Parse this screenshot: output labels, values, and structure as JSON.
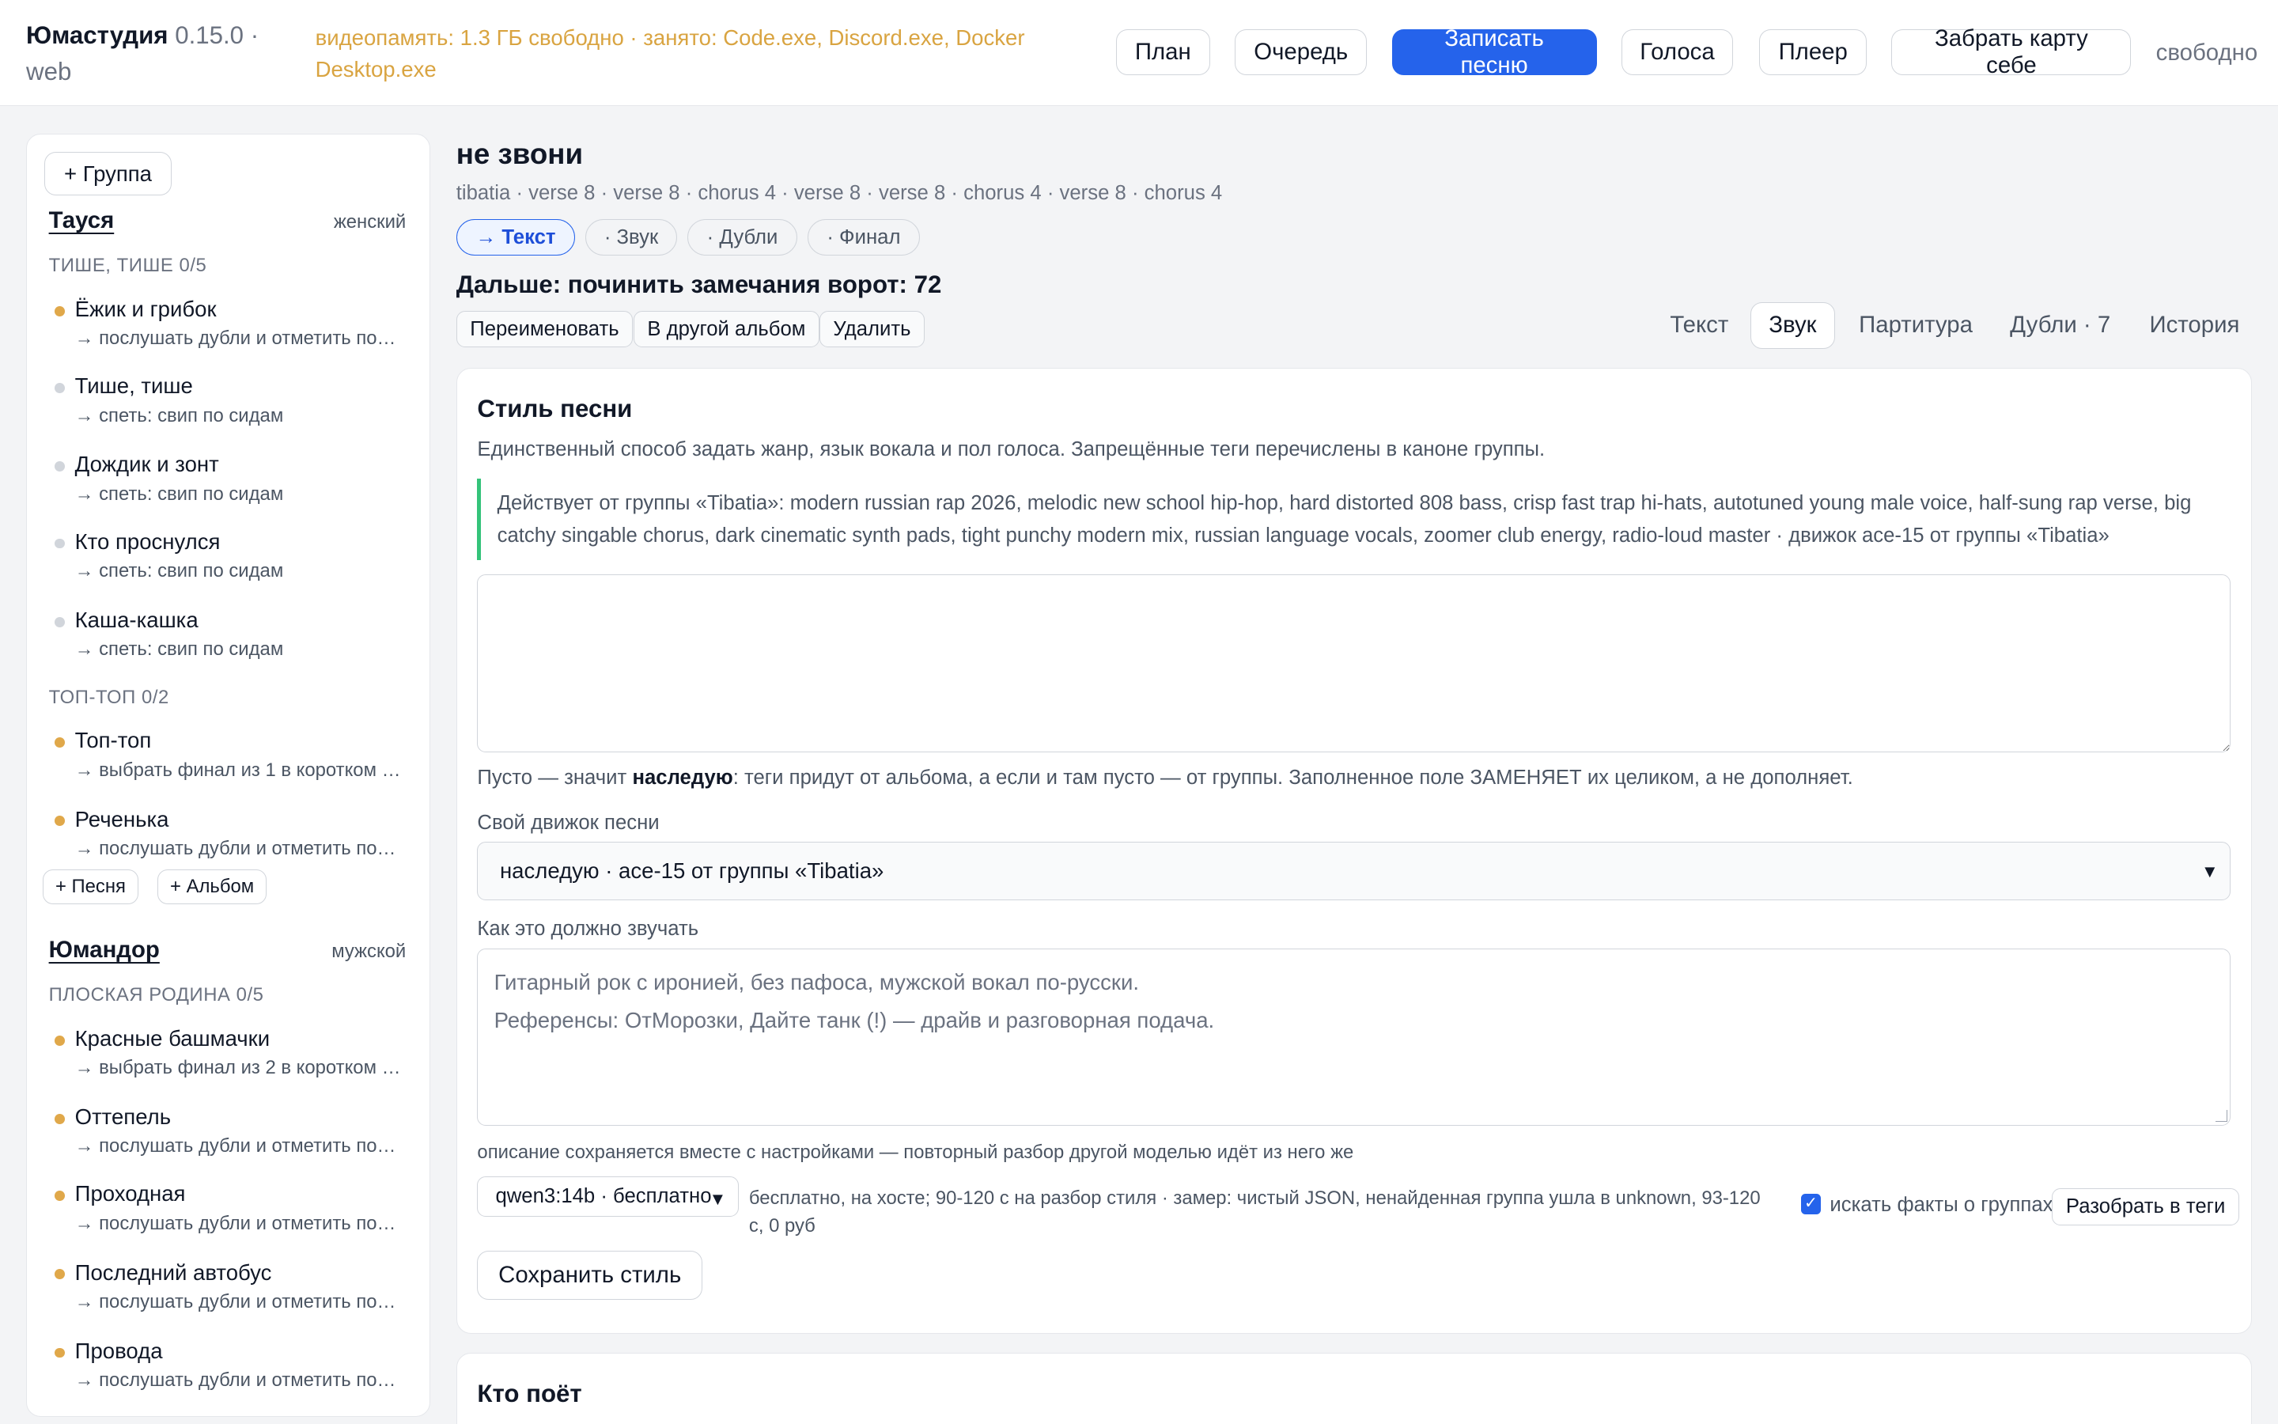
{
  "header": {
    "app_name": "Юмастудия",
    "version": "0.15.0 · web",
    "vram_status": "видеопамять: 1.3 ГБ свободно · занято: Code.exe, Discord.exe, Docker Desktop.exe",
    "nav": {
      "plan": "План",
      "queue": "Очередь",
      "record": "Записать песню",
      "voices": "Голоса",
      "player": "Плеер",
      "take_card": "Забрать карту себе"
    },
    "status": "свободно"
  },
  "sidebar": {
    "add_group": "+ Группа",
    "add_song": "+ Песня",
    "add_album": "+ Альбом",
    "groups": [
      {
        "name": "Тауся",
        "voice": "женский",
        "albums": [
          {
            "title": "ТИШЕ, ТИШЕ 0/5",
            "songs": [
              {
                "title": "Ёжик и грибок",
                "next": "→ послушать дубли и отметить понравившиеся",
                "status": "orange"
              },
              {
                "title": "Тише, тише",
                "next": "→ спеть: свип по сидам",
                "status": "gray"
              },
              {
                "title": "Дождик и зонт",
                "next": "→ спеть: свип по сидам",
                "status": "gray"
              },
              {
                "title": "Кто проснулся",
                "next": "→ спеть: свип по сидам",
                "status": "gray"
              },
              {
                "title": "Каша-кашка",
                "next": "→ спеть: свип по сидам",
                "status": "gray"
              }
            ]
          },
          {
            "title": "ТОП-ТОП 0/2",
            "songs": [
              {
                "title": "Топ-топ",
                "next": "→ выбрать финал из 1 в коротком списке",
                "status": "orange"
              },
              {
                "title": "Реченька",
                "next": "→ послушать дубли и отметить понравившиеся",
                "status": "orange"
              }
            ]
          }
        ]
      },
      {
        "name": "Юмандор",
        "voice": "мужской",
        "albums": [
          {
            "title": "ПЛОСКАЯ РОДИНА 0/5",
            "songs": [
              {
                "title": "Красные башмачки",
                "next": "→ выбрать финал из 2 в коротком списке",
                "status": "orange"
              },
              {
                "title": "Оттепель",
                "next": "→ послушать дубли и отметить понравившиеся",
                "status": "orange"
              },
              {
                "title": "Проходная",
                "next": "→ послушать дубли и отметить понравившиеся",
                "status": "orange"
              },
              {
                "title": "Последний автобус",
                "next": "→ послушать дубли и отметить понравившиеся",
                "status": "orange"
              },
              {
                "title": "Провода",
                "next": "→ послушать дубли и отметить понравившиеся",
                "status": "orange"
              }
            ]
          }
        ]
      }
    ]
  },
  "song": {
    "title": "не звони",
    "meta": "tibatia · verse 8 · verse 8 · chorus 4 · verse 8 · verse 8 · chorus 4 · verse 8 · chorus 4",
    "pipeline": [
      "→ Текст",
      "· Звук",
      "· Дубли",
      "· Финал"
    ],
    "next_step": "Дальше: починить замечания ворот: 72",
    "actions": {
      "rename": "Переименовать",
      "move": "В другой альбом",
      "delete": "Удалить"
    },
    "tabs": [
      "Текст",
      "Звук",
      "Партитура",
      "Дубли · 7",
      "История"
    ],
    "active_tab": "Звук"
  },
  "style_card": {
    "title": "Стиль песни",
    "description": "Единственный способ задать жанр, язык вокала и пол голоса. Запрещённые теги перечислены в каноне группы.",
    "inherited": "Действует от группы «Tibatia»: modern russian rap 2026, melodic new school hip-hop, hard distorted 808 bass, crisp fast trap hi-hats, autotuned young male voice, half-sung rap verse, big catchy singable chorus, dark cinematic synth pads, tight punchy modern mix, russian language vocals, zoomer club energy, radio-loud master · движок ace-15 от группы «Tibatia»",
    "style_value": "",
    "hint_before": "Пусто — значит ",
    "hint_bold": "наследую",
    "hint_after": ": теги придут от альбома, а если и там пусто — от группы. Заполненное поле ЗАМЕНЯЕТ их целиком, а не дополняет.",
    "engine_label": "Свой движок песни",
    "engine_value": "наследую · ace-15 от группы «Tibatia»",
    "sound_label": "Как это должно звучать",
    "sound_placeholder_1": "Гитарный рок с иронией, без пафоса, мужской вокал по-русски.",
    "sound_placeholder_2": "Референсы: ОтМорозки, Дайте танк (!) — драйв и разговорная подача.",
    "saved_note": "описание сохраняется вместе с настройками — повторный разбор другой моделью идёт из него же",
    "model_value": "qwen3:14b · бесплатно",
    "model_note": "бесплатно, на хосте; 90-120 с на разбор стиля · замер: чистый JSON, ненайденная группа ушла в unknown, 93-120 с, 0 руб",
    "facts_checkbox": "искать факты о группах",
    "facts_checked": true,
    "parse_button": "Разобрать в теги",
    "save_button": "Сохранить стиль"
  },
  "who_card": {
    "title": "Кто поёт"
  },
  "colors": {
    "accent": "#2563eb",
    "warning": "#d9a441",
    "success": "#34c37a",
    "dot_active": "#e0a84a",
    "dot_idle": "#d1d5db"
  }
}
